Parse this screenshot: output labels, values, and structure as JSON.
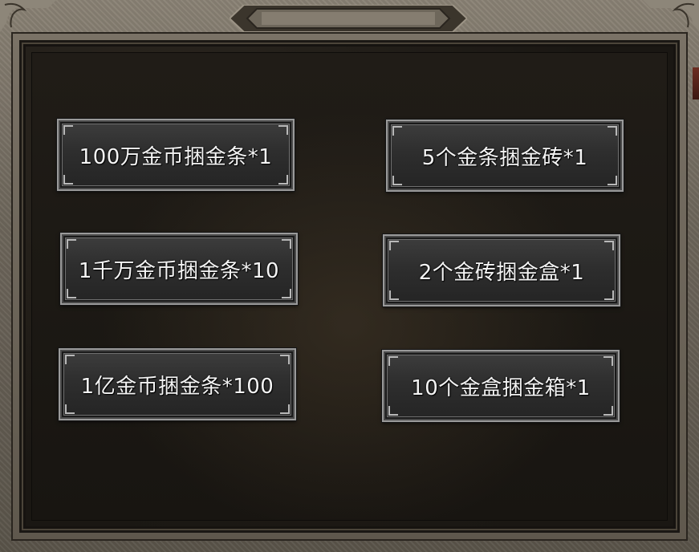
{
  "window": {
    "title": ""
  },
  "buttons": [
    {
      "label": "100万金币捆金条*1"
    },
    {
      "label": "5个金条捆金砖*1"
    },
    {
      "label": "1千万金币捆金条*10"
    },
    {
      "label": "2个金砖捆金盒*1"
    },
    {
      "label": "1亿金币捆金条*100"
    },
    {
      "label": "10个金盒捆金箱*1"
    }
  ],
  "colors": {
    "frame": "#6d665b",
    "panel": "#1c1914",
    "button_face": "#2e2e2e",
    "button_border": "#9a9a9a",
    "button_text": "#f4f4f4",
    "side_notch": "#6d2d22"
  }
}
